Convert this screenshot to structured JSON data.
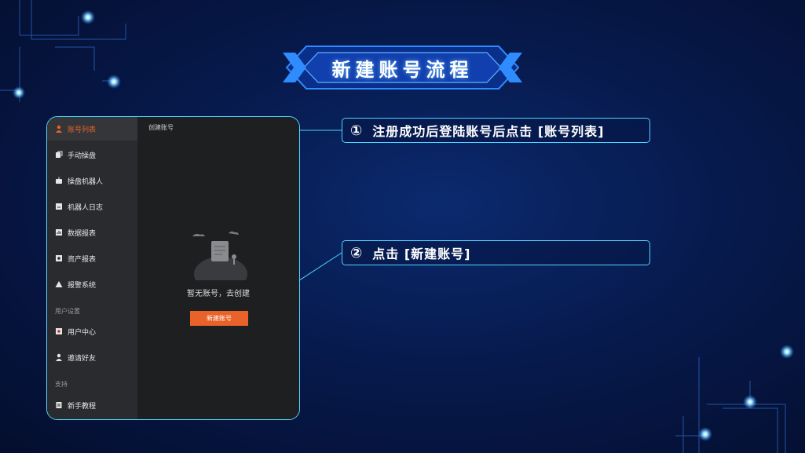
{
  "title": "新建账号流程",
  "callouts": [
    {
      "num": "①",
      "text": "注册成功后登陆账号后点击 [账号列表]"
    },
    {
      "num": "②",
      "text": "点击 [新建账号]"
    }
  ],
  "app": {
    "sidebar": {
      "items": [
        {
          "label": "账号列表",
          "icon": "user-icon",
          "active": true
        },
        {
          "label": "手动操盘",
          "icon": "manual-trade-icon"
        },
        {
          "label": "操盘机器人",
          "icon": "robot-icon"
        },
        {
          "label": "机器人日志",
          "icon": "log-icon"
        },
        {
          "label": "数据报表",
          "icon": "chart-icon"
        },
        {
          "label": "资产报表",
          "icon": "asset-icon"
        },
        {
          "label": "报警系统",
          "icon": "alert-icon"
        }
      ],
      "section_user": "用户设置",
      "user_items": [
        {
          "label": "用户中心",
          "icon": "user-center-icon"
        },
        {
          "label": "邀请好友",
          "icon": "invite-icon"
        }
      ],
      "section_support": "支持",
      "support_items": [
        {
          "label": "新手教程",
          "icon": "tutorial-icon"
        }
      ]
    },
    "main": {
      "tab": "创建账号",
      "empty_text": "暂无账号，去创建",
      "new_button": "新建账号"
    }
  },
  "colors": {
    "accent": "#e8622a",
    "cyan": "#4fd3ff",
    "bg": "#071a4d"
  }
}
